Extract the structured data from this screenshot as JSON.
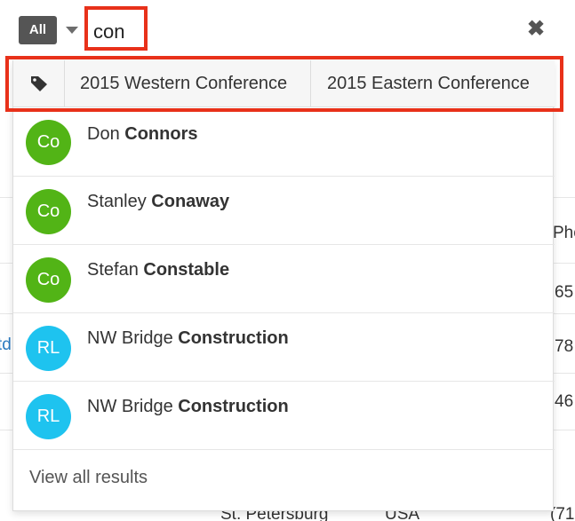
{
  "search": {
    "module_label": "All",
    "query": "con"
  },
  "tags": [
    "2015 Western Conference",
    "2015 Eastern Conference"
  ],
  "results": [
    {
      "initials": "Co",
      "name_prefix": "Don",
      "name_match": "Connors",
      "avatar_color": "#52b416"
    },
    {
      "initials": "Co",
      "name_prefix": "Stanley",
      "name_match": "Conaway",
      "avatar_color": "#52b416"
    },
    {
      "initials": "Co",
      "name_prefix": "Stefan",
      "name_match": "Constable",
      "avatar_color": "#52b416"
    },
    {
      "initials": "RL",
      "name_prefix": "NW Bridge",
      "name_match": "Construction",
      "avatar_color": "#1ec3ef"
    },
    {
      "initials": "RL",
      "name_prefix": "NW Bridge",
      "name_match": "Construction",
      "avatar_color": "#1ec3ef"
    }
  ],
  "view_all_label": "View all results",
  "background": {
    "header_fragment": "Pho",
    "left_link_fragment": "td",
    "phone_fragments": [
      "65",
      "78",
      "46",
      "(71"
    ],
    "city": "St. Petersburg",
    "country": "USA"
  },
  "colors": {
    "highlight": "#e8311a",
    "module_button": "#555555",
    "link": "#2a7ac0"
  }
}
